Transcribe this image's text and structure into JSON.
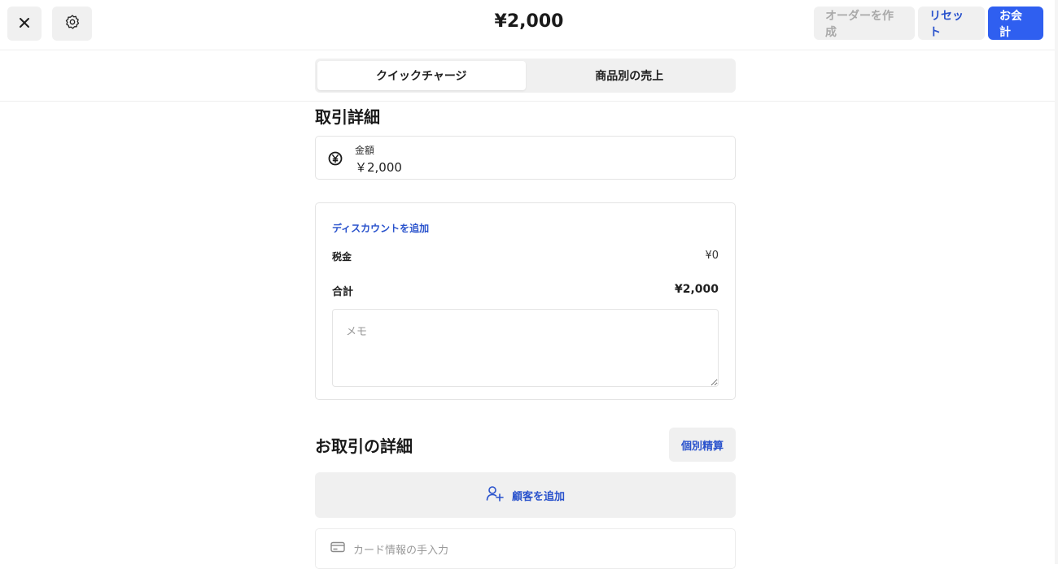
{
  "header": {
    "amount": "¥2,000",
    "create_order_label": "オーダーを作成",
    "reset_label": "リセット",
    "checkout_label": "お会計"
  },
  "tabs": [
    {
      "label": "クイックチャージ",
      "active": true
    },
    {
      "label": "商品別の売上",
      "active": false
    }
  ],
  "transaction": {
    "title": "取引詳細",
    "amount_label": "金額",
    "amount_value": "￥2,000"
  },
  "summary": {
    "add_discount": "ディスカウントを追加",
    "tax_label": "税金",
    "tax_value": "¥0",
    "total_label": "合計",
    "total_value": "¥2,000",
    "memo_placeholder": "メモ"
  },
  "details": {
    "title": "お取引の詳細",
    "split_label": "個別精算",
    "add_customer_label": "顧客を追加",
    "card_entry_label": "カード情報の手入力"
  },
  "colors": {
    "accent": "#2f5ff0",
    "link": "#2952cc",
    "button_bg": "#f0f0f0",
    "disabled_text": "#a9a9a9"
  },
  "icons": {
    "close": "close-icon",
    "settings": "gear-icon",
    "currency": "yen-circle-icon",
    "add_customer": "person-plus-icon",
    "card": "credit-card-icon"
  }
}
